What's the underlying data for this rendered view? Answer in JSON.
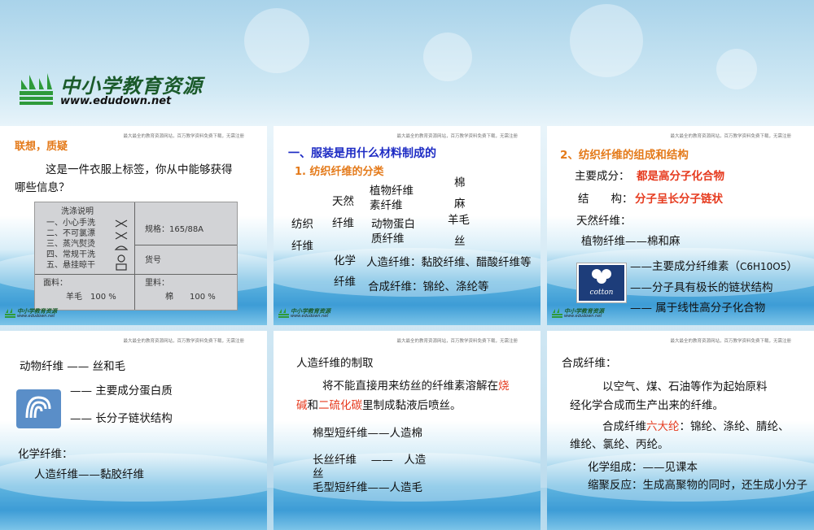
{
  "header": {
    "logo_text": "中小学教育资源",
    "logo_url": "www.edudown.net"
  },
  "footer_logo": {
    "text": "中小学教育资源",
    "url": "www.edudown.net"
  },
  "top_note": "最大最全的教育资源网站，百万教学资料免费下载，无需注册",
  "slide1": {
    "title": "联想，质疑",
    "line1": "这是一件衣服上标签，你从中能够获得",
    "line2": "哪些信息？",
    "tag": {
      "header": "洗涤说明",
      "items": [
        "一、小心手洗",
        "二、不可氯漂",
        "三、蒸汽熨烫",
        "四、常规干洗",
        "五、悬挂晾干"
      ],
      "spec": "规格：165/88A",
      "code": "货号",
      "face_label": "面料：",
      "face_value": "羊毛　100 %",
      "lining_label": "里料：",
      "lining_value": "棉　　100 %"
    }
  },
  "slide2": {
    "title": "一、服装是用什么材料制成的",
    "subtitle": "1. 纺织纤维的分类",
    "textile": [
      "纺织",
      "纤维"
    ],
    "natural": [
      "天然",
      "纤维"
    ],
    "plant": [
      "植物纤维",
      "素纤维"
    ],
    "animal": [
      "动物蛋白",
      "质纤维"
    ],
    "plant_items": [
      "棉",
      "麻"
    ],
    "animal_items": [
      "羊毛",
      "丝"
    ],
    "chemical": [
      "化学",
      "纤维"
    ],
    "artificial": "人造纤维：黏胶纤维、醋酸纤维等",
    "synthetic": "合成纤维：锦纶、涤纶等"
  },
  "slide3": {
    "title": "2、纺织纤维的组成和结构",
    "main_label": "主要成分：",
    "main_value": "都是高分子化合物",
    "struct_label": "结　　构：",
    "struct_value": "分子呈长分子链状",
    "natural": "天然纤维：",
    "plant": "植物纤维——棉和麻",
    "point1": "——主要成分纤维素（",
    "formula": "C6H10O5",
    "point1_end": "）",
    "point2": "——分子具有极长的链状结构",
    "point3": "—— 属于线性高分子化合物",
    "cotton_logo": "cotton"
  },
  "slide4": {
    "title": "动物纤维 —— 丝和毛",
    "point1": "—— 主要成分蛋白质",
    "point2": "—— 长分子链状结构",
    "chemical": "化学纤维：",
    "artificial": "人造纤维——黏胶纤维"
  },
  "slide5": {
    "title": "人造纤维的制取",
    "p1": "将不能直接用来纺丝的纤维素溶解在",
    "p1_red": "烧",
    "p2_red1": "碱",
    "p2_mid": "和",
    "p2_red2": "二硫化碳",
    "p2_end": "里制成黏液后喷丝。",
    "item1": "棉型短纤维——人造棉",
    "item2": "长丝纤维　 ——　人造",
    "item2b": "丝",
    "item3": "毛型短纤维——人造毛"
  },
  "slide6": {
    "title": "合成纤维：",
    "p1": "以空气、煤、石油等作为起始原料",
    "p2": "经化学合成而生产出来的纤维。",
    "p3_pre": "合成纤维",
    "p3_red": "六大纶",
    "p3_post": "：锦纶、涤纶、腈纶、",
    "p4": "维纶、氯纶、丙纶。",
    "p5": "化学组成：——见课本",
    "p6": "缩聚反应：生成高聚物的同时，还生成小分子"
  }
}
